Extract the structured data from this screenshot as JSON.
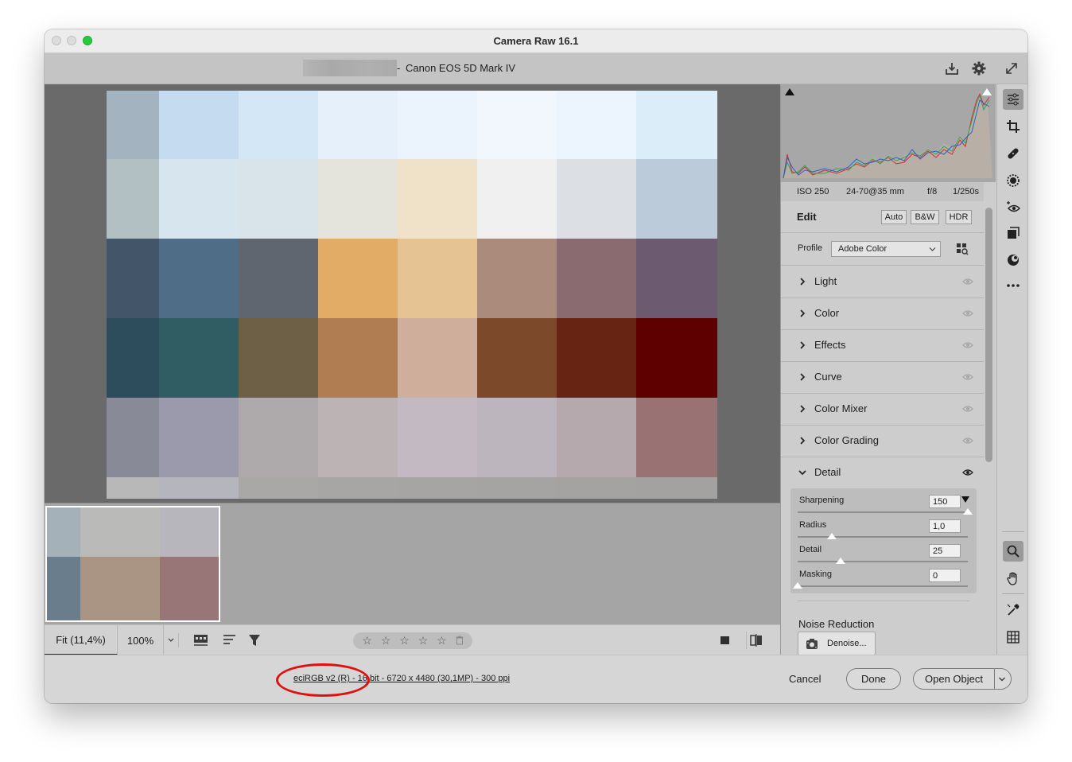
{
  "window": {
    "title": "Camera Raw 16.1",
    "camera_model": "Canon EOS 5D Mark IV"
  },
  "icons": {
    "save": "download-tray-icon",
    "settings": "gear-icon",
    "fullscreen": "expand-arrows-icon"
  },
  "histogram": {
    "metadata": {
      "iso": "ISO 250",
      "lens": "24-70@35 mm",
      "aperture": "f/8",
      "shutter": "1/250s"
    }
  },
  "edit": {
    "heading": "Edit",
    "buttons": [
      "Auto",
      "B&W",
      "HDR"
    ],
    "profile_label": "Profile",
    "profile_value": "Adobe Color",
    "sections": [
      "Light",
      "Color",
      "Effects",
      "Curve",
      "Color Mixer",
      "Color Grading",
      "Detail"
    ],
    "detail": {
      "sliders": [
        {
          "label": "Sharpening",
          "value": "150",
          "level": 1.0
        },
        {
          "label": "Radius",
          "value": "1,0",
          "level": 0.2
        },
        {
          "label": "Detail",
          "value": "25",
          "level": 0.25
        },
        {
          "label": "Masking",
          "value": "0",
          "level": 0.0
        }
      ],
      "noise_reduction_label": "Noise Reduction",
      "denoise_label": "Denoise..."
    }
  },
  "bottombar": {
    "fit_label": "Fit (11,4%)",
    "zoom_label": "100%",
    "rating_stars": 5,
    "star_glyph": "☆"
  },
  "footer": {
    "workflow_info": "eciRGB v2 (R) - 16 bit - 6720 x 4480 (30,1MP) - 300 ppi",
    "cancel": "Cancel",
    "done": "Done",
    "open_object": "Open Object"
  },
  "colors": {
    "annotation": "#e01010",
    "traffic_close": "#d9d9d9",
    "traffic_min": "#d9d9d9",
    "traffic_max": "#27c93f"
  },
  "image_grid": {
    "rows": [
      [
        "#a3b3bf",
        "#c5dbf0",
        "#d4e7f6",
        "#e5f0fa",
        "#ebf4fd",
        "#f1f7fd",
        "#ecf4fd",
        "#dcedfa"
      ],
      [
        "#b2bfc3",
        "#d6e5ee",
        "#d8e3ea",
        "#e4e4dc",
        "#efe2c8",
        "#f1f0f1",
        "#dcdfe4",
        "#bccbd9"
      ],
      [
        "#435568",
        "#506d87",
        "#5f6670",
        "#e2ac67",
        "#e5c393",
        "#ab8b7c",
        "#8a6b70",
        "#6c5a70"
      ],
      [
        "#2d4c5c",
        "#305c63",
        "#6e5f47",
        "#b07d52",
        "#cfae9c",
        "#7c4a2b",
        "#682413",
        "#5e0000"
      ],
      [
        "#898a97",
        "#9a9aac",
        "#aeaaab",
        "#bcb3b5",
        "#c2b9c3",
        "#bcb5bd",
        "#b5a9ae",
        "#997374"
      ],
      [
        "#b8b8b8",
        "#b4b5bd",
        "#a9a8a6",
        "#a7a6a4",
        "#a6a5a4",
        "#a5a4a3",
        "#a4a3a2",
        "#a3a2a1"
      ]
    ]
  },
  "thumbnail_grid": {
    "rows": [
      [
        "#a5b1b9",
        "#babab9",
        "#b7b6bd"
      ],
      [
        "#6a7d8c",
        "#aa9585",
        "#987577"
      ]
    ]
  }
}
